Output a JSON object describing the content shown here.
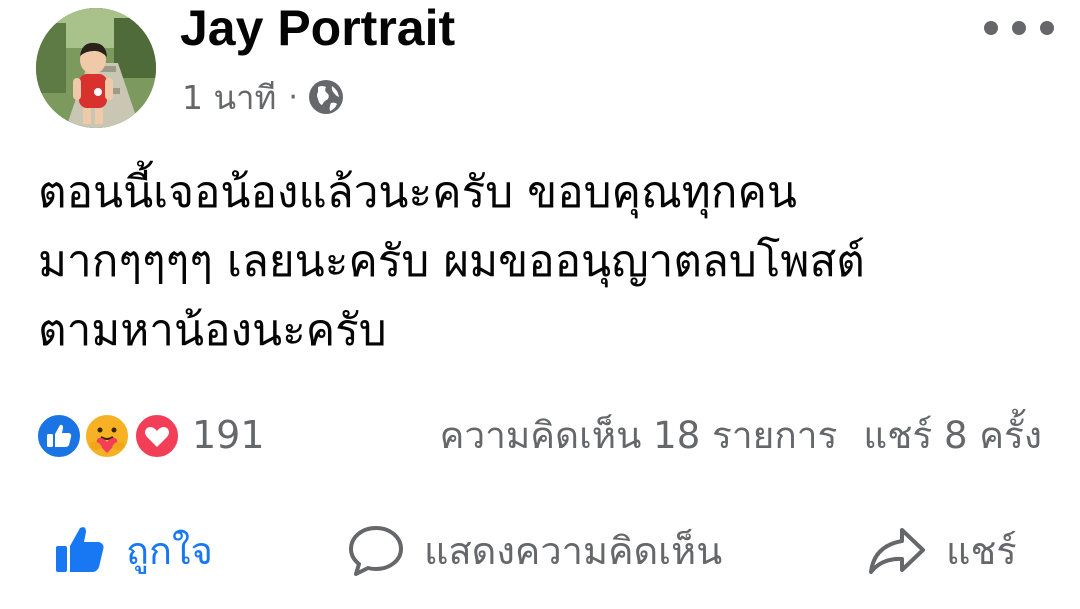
{
  "post": {
    "author": "Jay Portrait",
    "time": "1 นาที",
    "privacy_icon": "globe-icon",
    "message": "ตอนนี้เจอน้องแล้วนะครับ ขอบคุณทุกคน\nมากๆๆๆๆ เลยนะครับ ผมขออนุญาตลบโพสต์\nตามหาน้องนะครับ",
    "reactions": {
      "icons": [
        "like-reaction-icon",
        "care-reaction-icon",
        "love-reaction-icon"
      ],
      "count": "191"
    },
    "comments_text": "ความคิดเห็น 18 รายการ",
    "shares_text": "แชร์ 8 ครั้ง"
  },
  "actions": {
    "like_label": "ถูกใจ",
    "comment_label": "แสดงความคิดเห็น",
    "share_label": "แชร์"
  },
  "colors": {
    "accent": "#1877f2",
    "secondary_text": "#65676b",
    "primary_text": "#050505",
    "love": "#f33e58"
  }
}
